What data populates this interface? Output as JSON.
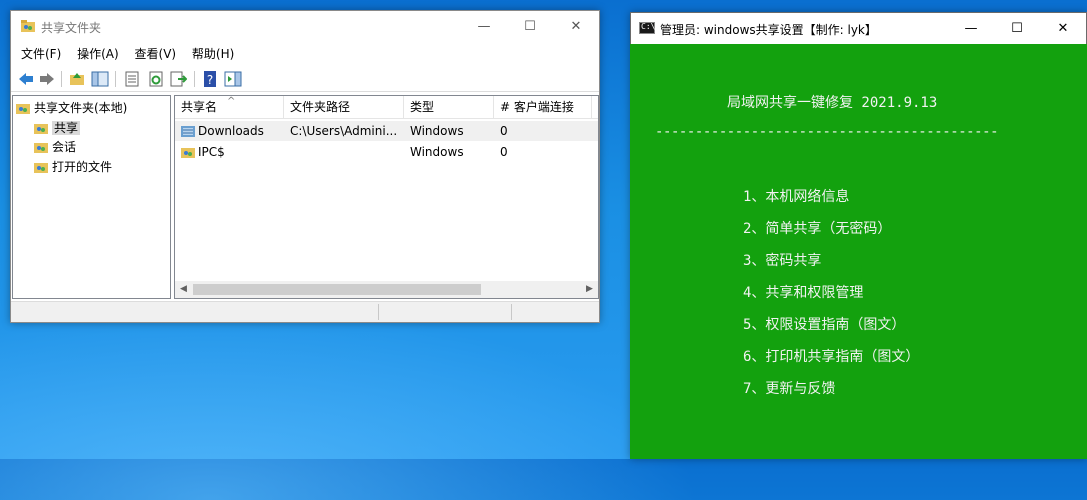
{
  "mmc": {
    "title": "共享文件夹",
    "menu": [
      "文件(F)",
      "操作(A)",
      "查看(V)",
      "帮助(H)"
    ],
    "tree": {
      "root": "共享文件夹(本地)",
      "items": [
        "共享",
        "会话",
        "打开的文件"
      ]
    },
    "columns": [
      "共享名",
      "文件夹路径",
      "类型",
      "# 客户端连接"
    ],
    "sort_indicator": "^",
    "rows": [
      {
        "name": "Downloads",
        "path": "C:\\Users\\Admini...",
        "type": "Windows",
        "clients": "0"
      },
      {
        "name": "IPC$",
        "path": "",
        "type": "Windows",
        "clients": "0"
      }
    ]
  },
  "console": {
    "title": "管理员: windows共享设置【制作: lyk】",
    "header": "局域网共享一键修复 2021.9.13",
    "divider": "-------------------------------------------",
    "menu": [
      "1、本机网络信息",
      "2、简单共享（无密码）",
      "3、密码共享",
      "4、共享和权限管理",
      "5、权限设置指南（图文）",
      "6、打印机共享指南（图文）",
      "7、更新与反馈"
    ],
    "background_color": "#13a10e"
  },
  "window_controls": {
    "minimize": "—",
    "maximize": "☐",
    "close": "✕"
  }
}
